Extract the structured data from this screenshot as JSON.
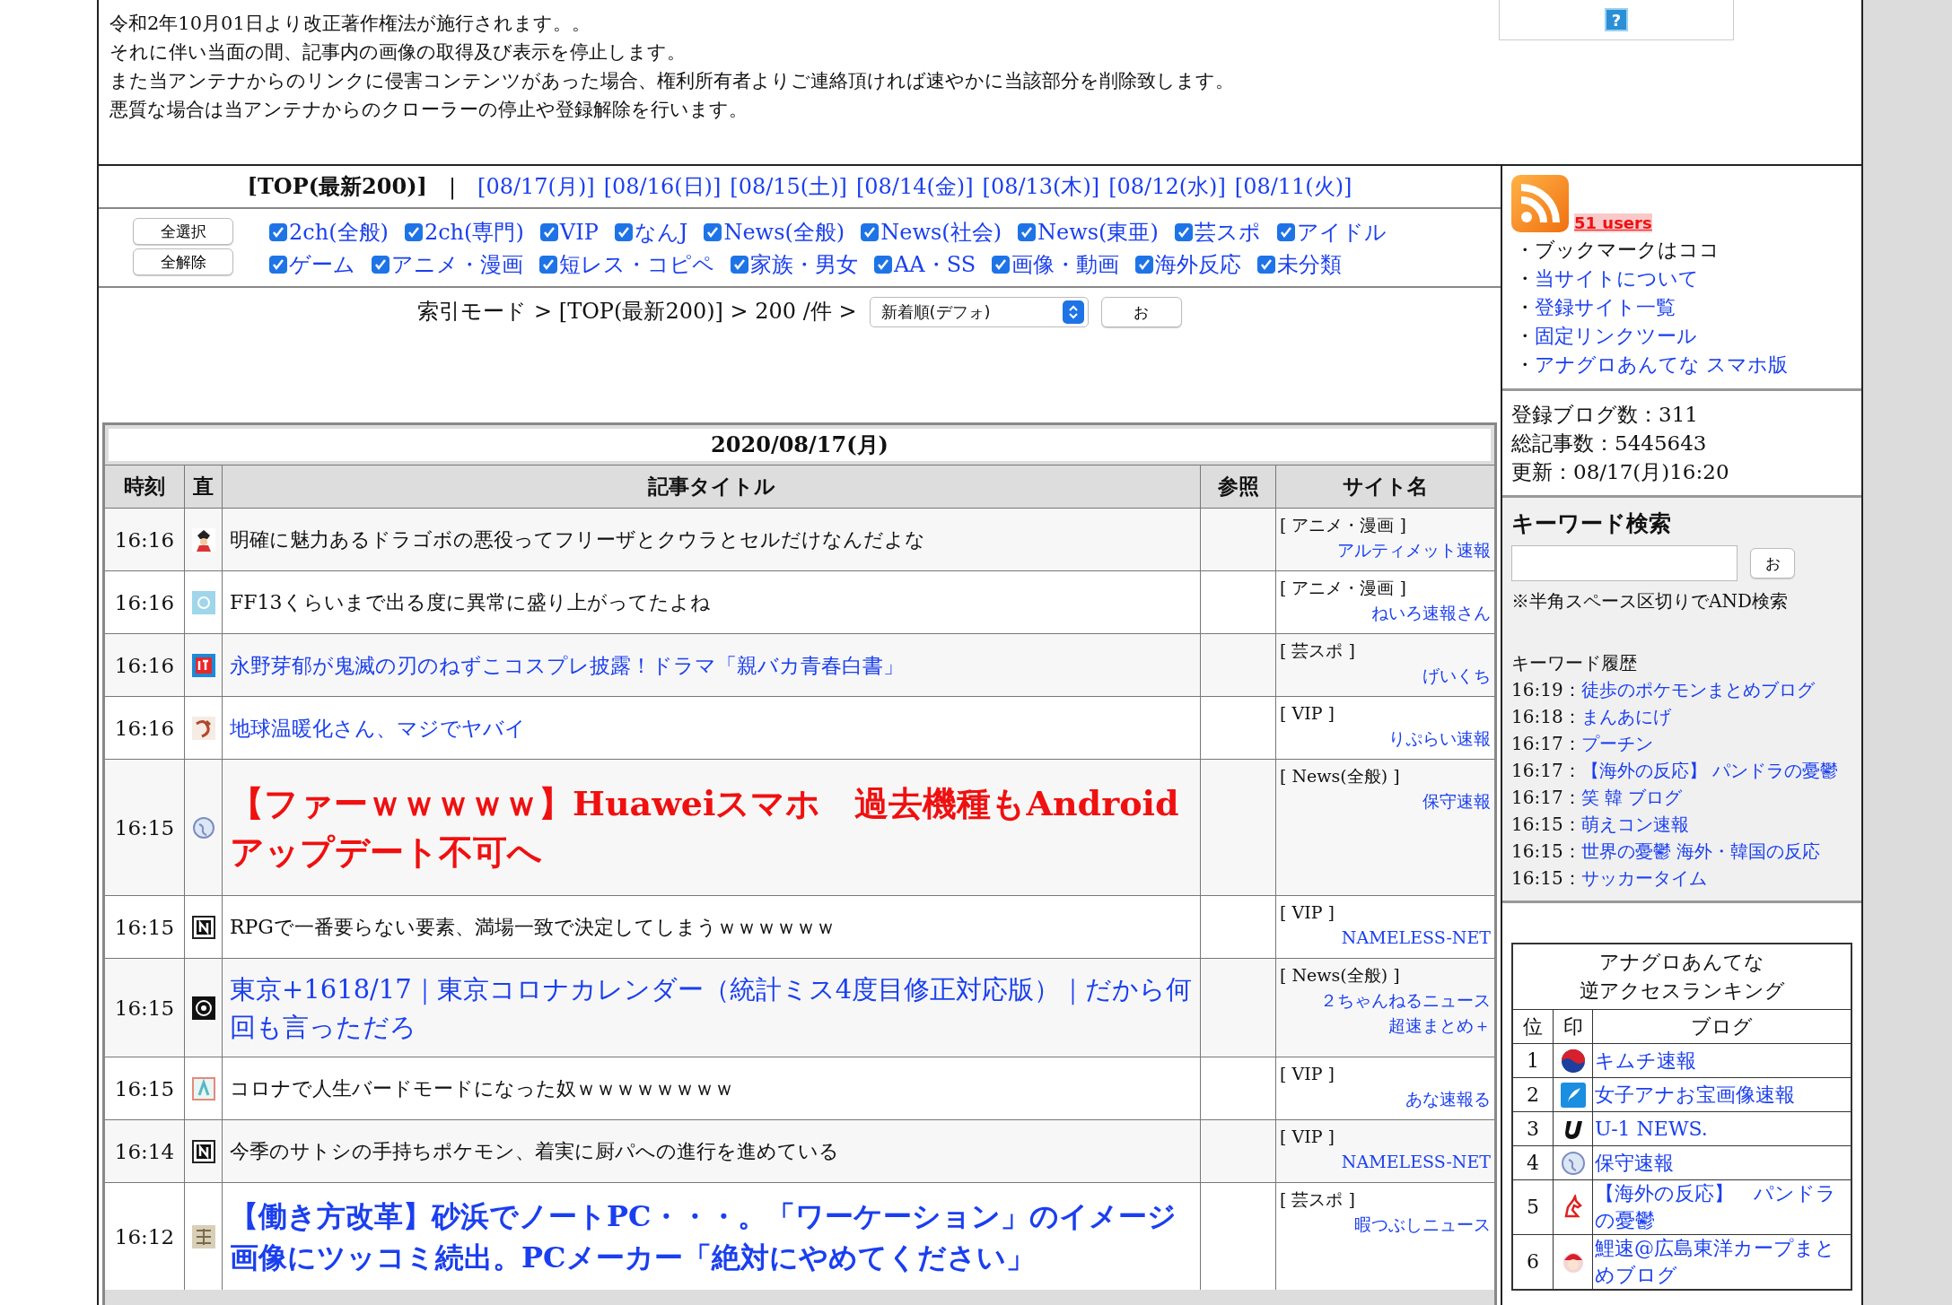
{
  "notice": {
    "lines": [
      "令和2年10月01日より改正著作権法が施行されます。。",
      "それに伴い当面の間、記事内の画像の取得及び表示を停止します。",
      "また当アンテナからのリンクに侵害コンテンツがあった場合、権利所有者よりご連絡頂ければ速やかに当該部分を削除致します。",
      "悪質な場合は当アンテナからのクローラーの停止や登録解除を行います。"
    ],
    "help": "?"
  },
  "date_nav": {
    "current": "[TOP(最新200)]",
    "separator": "|",
    "dates": [
      "[08/17(月)]",
      "[08/16(日)]",
      "[08/15(土)]",
      "[08/14(金)]",
      "[08/13(木)]",
      "[08/12(水)]",
      "[08/11(火)]"
    ]
  },
  "filter": {
    "buttons": [
      "全選択",
      "全解除"
    ],
    "categories": [
      {
        "label": "2ch(全般)",
        "checked": true
      },
      {
        "label": "2ch(専門)",
        "checked": true
      },
      {
        "label": "VIP",
        "checked": true
      },
      {
        "label": "なんJ",
        "checked": true
      },
      {
        "label": "News(全般)",
        "checked": true
      },
      {
        "label": "News(社会)",
        "checked": true
      },
      {
        "label": "News(東亜)",
        "checked": true
      },
      {
        "label": "芸スポ",
        "checked": true
      },
      {
        "label": "アイドル",
        "checked": true
      },
      {
        "label": "ゲーム",
        "checked": true
      },
      {
        "label": "アニメ・漫画",
        "checked": true
      },
      {
        "label": "短レス・コピペ",
        "checked": true
      },
      {
        "label": "家族・男女",
        "checked": true
      },
      {
        "label": "AA・SS",
        "checked": true
      },
      {
        "label": "画像・動画",
        "checked": true
      },
      {
        "label": "海外反応",
        "checked": true
      },
      {
        "label": "未分類",
        "checked": true
      }
    ]
  },
  "mode": {
    "breadcrumb": "索引モード > [TOP(最新200)] > 200 /件 >",
    "sort": "新着順(デフォ)",
    "submit": "お"
  },
  "table": {
    "date": "2020/08/17(月)",
    "columns": [
      "時刻",
      "直",
      "記事タイトル",
      "参照",
      "サイト名"
    ],
    "rows": [
      {
        "time": "16:16",
        "title": "明確に魅力あるドラゴボの悪役ってフリーザとクウラとセルだけなんだよな",
        "kind": "plain",
        "category": "[ アニメ・漫画 ]",
        "sites": [
          "アルティメット速報"
        ]
      },
      {
        "time": "16:16",
        "title": "FF13くらいまで出る度に異常に盛り上がってたよね",
        "kind": "plain",
        "category": "[ アニメ・漫画 ]",
        "sites": [
          "ねいろ速報さん"
        ]
      },
      {
        "time": "16:16",
        "title": "永野芽郁が鬼滅の刃のねずこコスプレ披露！ドラマ「親バカ青春白書」",
        "kind": "link",
        "category": "[ 芸スポ ]",
        "sites": [
          "げいくち"
        ]
      },
      {
        "time": "16:16",
        "title": "地球温暖化さん、マジでヤバイ",
        "kind": "link",
        "category": "[ VIP ]",
        "sites": [
          "りぷらい速報"
        ]
      },
      {
        "time": "16:15",
        "title": "【ファーｗｗｗｗｗ】Huaweiスマホ　過去機種もAndroidアップデート不可へ",
        "kind": "red-headline",
        "category": "[ News(全般) ]",
        "sites": [
          "保守速報"
        ]
      },
      {
        "time": "16:15",
        "title": "RPGで一番要らない要素、満場一致で決定してしまうｗｗｗｗｗｗ",
        "kind": "plain",
        "category": "[ VIP ]",
        "sites": [
          "NAMELESS-NET"
        ]
      },
      {
        "time": "16:15",
        "title": "東京+1618/17｜東京コロナカレンダー（統計ミス4度目修正対応版）｜だから何回も言っただろ",
        "kind": "big-link",
        "category": "[ News(全般) ]",
        "sites": [
          "２ちゃんねるニュース",
          "超速まとめ＋"
        ]
      },
      {
        "time": "16:15",
        "title": "コロナで人生バードモードになった奴ｗｗｗｗｗｗｗｗ",
        "kind": "plain",
        "category": "[ VIP ]",
        "sites": [
          "あな速報る"
        ]
      },
      {
        "time": "16:14",
        "title": "今季のサトシの手持ちポケモン、着実に厨パへの進行を進めている",
        "kind": "plain",
        "category": "[ VIP ]",
        "sites": [
          "NAMELESS-NET"
        ]
      },
      {
        "time": "16:12",
        "title": "【働き方改革】砂浜でノートPC・・・。「ワーケーション」のイメージ画像にツッコミ続出。PCメーカー「絶対にやめてください」",
        "kind": "blue-headline",
        "category": "[ 芸スポ ]",
        "sites": [
          "暇つぶしニュース"
        ]
      }
    ]
  },
  "sidebar": {
    "users": "51 users",
    "links": [
      {
        "bullet": "・",
        "label": "ブックマークはココ",
        "kind": "text"
      },
      {
        "bullet": "・",
        "label": "当サイトについて",
        "kind": "link"
      },
      {
        "bullet": "・",
        "label": "登録サイト一覧",
        "kind": "link"
      },
      {
        "bullet": "・",
        "label": "固定リンクツール",
        "kind": "link"
      },
      {
        "bullet": "・",
        "label": "アナグロあんてな スマホ版",
        "kind": "link"
      }
    ],
    "stats": [
      "登録ブログ数：311",
      "総記事数：5445643",
      "更新：08/17(月)16:20"
    ],
    "search": {
      "title": "キーワード検索",
      "submit": "お",
      "hint": "※半角スペース区切りでAND検索",
      "history_title": "キーワード履歴",
      "history": [
        {
          "time": "16:19：",
          "label": "徒歩のポケモンまとめブログ"
        },
        {
          "time": "16:18：",
          "label": "まんあにげ"
        },
        {
          "time": "16:17：",
          "label": "プーチン"
        },
        {
          "time": "16:17：",
          "label": "【海外の反応】 パンドラの憂鬱"
        },
        {
          "time": "16:17：",
          "label": "笑 韓 ブログ"
        },
        {
          "time": "16:15：",
          "label": "萌えコン速報"
        },
        {
          "time": "16:15：",
          "label": "世界の憂鬱 海外・韓国の反応"
        },
        {
          "time": "16:15：",
          "label": "サッカータイム"
        }
      ]
    },
    "ranking": {
      "title": "アナグロあんてな",
      "subtitle": "逆アクセスランキング",
      "columns": [
        "位",
        "印",
        "ブログ"
      ],
      "rows": [
        {
          "rank": "1",
          "blog": "キムチ速報"
        },
        {
          "rank": "2",
          "blog": "女子アナお宝画像速報"
        },
        {
          "rank": "3",
          "blog": "U-1 NEWS."
        },
        {
          "rank": "4",
          "blog": "保守速報"
        },
        {
          "rank": "5",
          "blog": "【海外の反応】　パンドラの憂鬱"
        },
        {
          "rank": "6",
          "blog": "鯉速@広島東洋カープまとめブログ"
        }
      ]
    }
  }
}
